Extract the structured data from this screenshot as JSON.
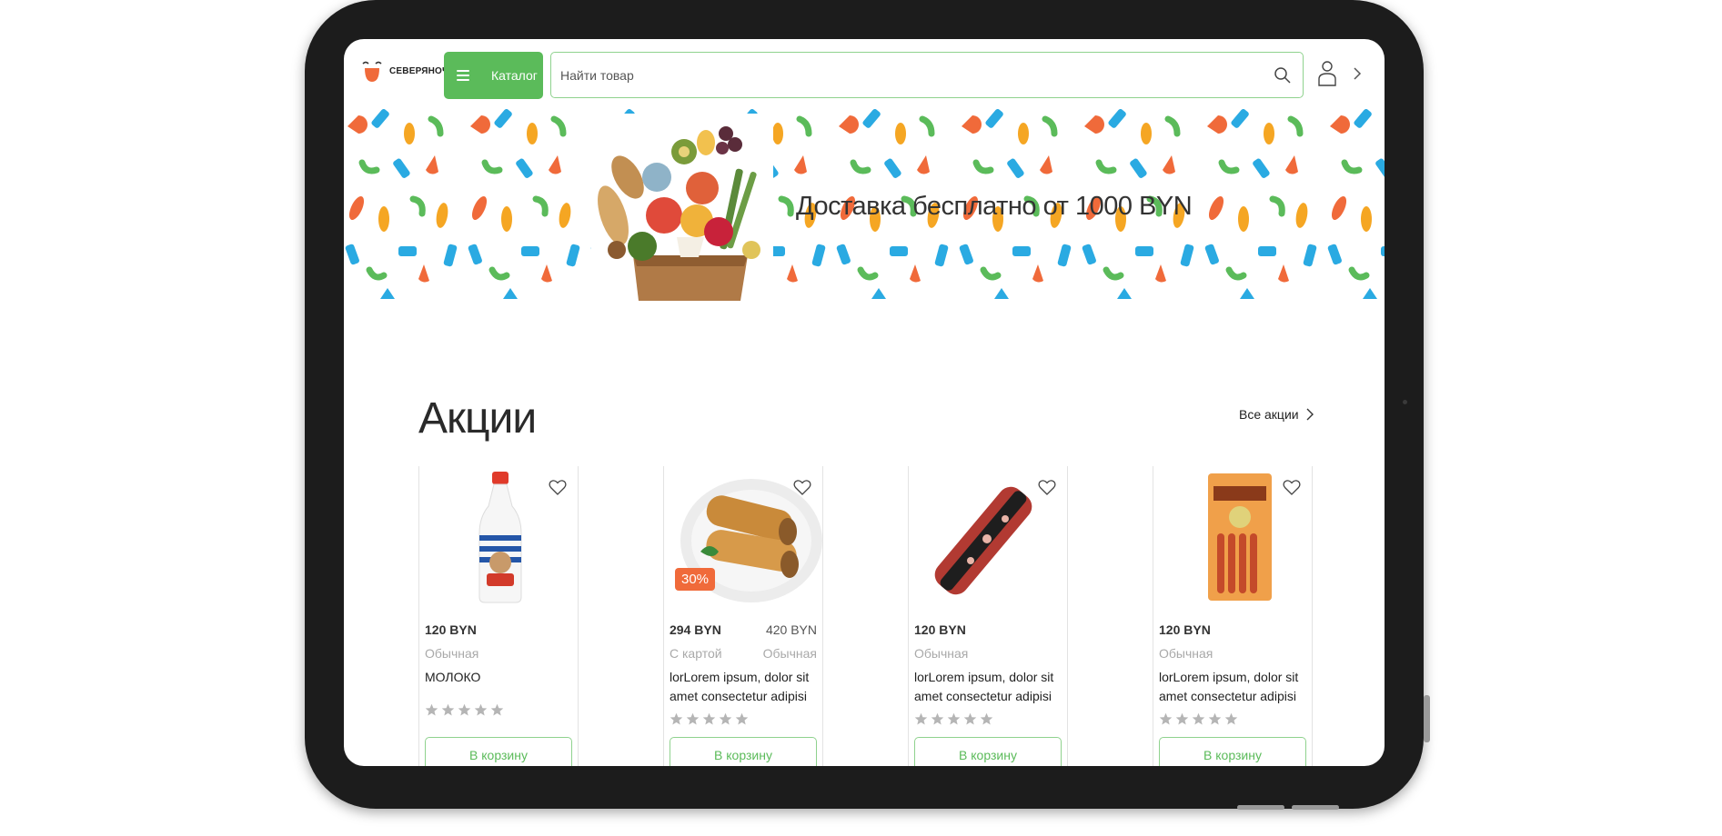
{
  "brand": {
    "name": "СЕВЕРЯНОЧКА"
  },
  "header": {
    "catalog_label": "Каталог",
    "search_placeholder": "Найти товар"
  },
  "banner": {
    "text": "Доставка бесплатно от 1000 BYN"
  },
  "promos": {
    "title": "Акции",
    "all_link": "Все акции",
    "cart_label": "В корзину",
    "products": [
      {
        "price": "120 BYN",
        "old_price": "",
        "type": "Обычная",
        "type_alt": "",
        "name": "МОЛОКО",
        "discount": "",
        "rating": 0
      },
      {
        "price": "294 BYN",
        "old_price": "420 BYN",
        "type": "С картой",
        "type_alt": "Обычная",
        "name": "lorLorem ipsum, dolor sit amet consectetur adipisi",
        "discount": "30%",
        "rating": 0
      },
      {
        "price": "120 BYN",
        "old_price": "",
        "type": "Обычная",
        "type_alt": "",
        "name": "lorLorem ipsum, dolor sit amet consectetur adipisi",
        "discount": "",
        "rating": 0
      },
      {
        "price": "120 BYN",
        "old_price": "",
        "type": "Обычная",
        "type_alt": "",
        "name": "lorLorem ipsum, dolor sit amet consectetur adipisi",
        "discount": "",
        "rating": 0
      }
    ]
  },
  "colors": {
    "accent": "#5bbb5a",
    "discount": "#f06a3a",
    "star": "#b5b5b5"
  }
}
